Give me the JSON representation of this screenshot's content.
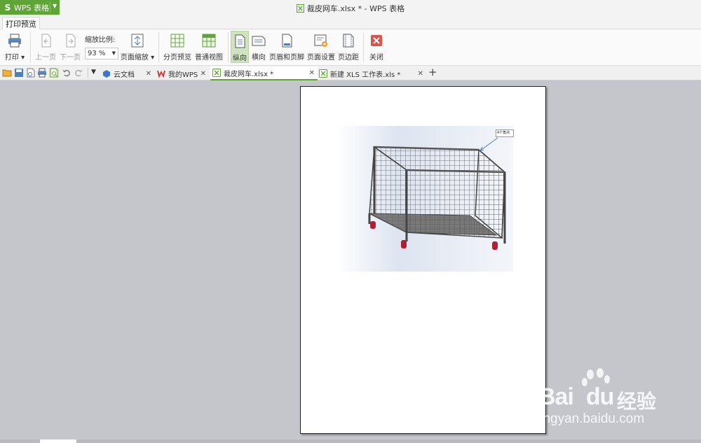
{
  "app": {
    "name": "WPS 表格",
    "logo": "S"
  },
  "window": {
    "title": "裁皮网车.xlsx * - WPS 表格"
  },
  "ribbon": {
    "active_tab": "打印预览"
  },
  "toolbar": {
    "print": "打印",
    "prev_page": "上一页",
    "next_page": "下一页",
    "zoom_label": "缩放比例:",
    "zoom_value": "93 %",
    "page_scale": "页面缩放",
    "page_break_preview": "分页预览",
    "normal_view": "普通视图",
    "portrait": "纵向",
    "landscape": "横向",
    "header_footer": "页眉和页脚",
    "page_setup": "页面设置",
    "margins": "页边距",
    "close": "关闭"
  },
  "tabs": [
    {
      "label": "云文档",
      "icon": "cloud-doc-icon"
    },
    {
      "label": "我的WPS",
      "icon": "wps-w-icon"
    },
    {
      "label": "裁皮网车.xlsx *",
      "icon": "spreadsheet-icon",
      "active": true
    },
    {
      "label": "新建 XLS 工作表.xls *",
      "icon": "spreadsheet-icon"
    }
  ],
  "preview": {
    "callout_text": "4个角点",
    "zoom_percent": 93
  },
  "watermark": {
    "brand": "Bai",
    "brand2": "du",
    "cn": "经验",
    "url": "jingyan.baidu.com"
  },
  "colors": {
    "wps_green": "#5fa436",
    "preview_bg": "#c4c6cc",
    "close_red": "#d9534f"
  }
}
